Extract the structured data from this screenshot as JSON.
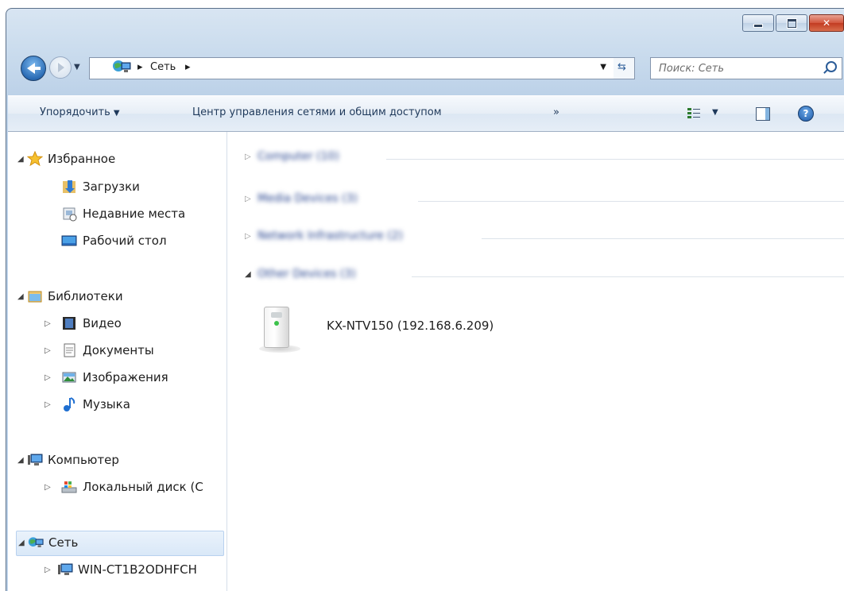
{
  "window": {
    "controls": {
      "minimize": "minimize-icon",
      "maximize": "maximize-icon",
      "close": "close-icon"
    }
  },
  "address": {
    "crumbs": [
      "Сеть"
    ],
    "search_placeholder": "Поиск: Сеть"
  },
  "toolbar": {
    "organize": "Упорядочить",
    "network_center": "Центр управления сетями и общим доступом",
    "more": "»"
  },
  "sidebar": {
    "favorites": {
      "label": "Избранное",
      "items": [
        "Загрузки",
        "Недавние места",
        "Рабочий стол"
      ]
    },
    "libraries": {
      "label": "Библиотеки",
      "items": [
        "Видео",
        "Документы",
        "Изображения",
        "Музыка"
      ]
    },
    "computer": {
      "label": "Компьютер",
      "items": [
        "Локальный диск (C"
      ]
    },
    "network": {
      "label": "Сеть",
      "items": [
        "WIN-CT1B2ODHFCH"
      ]
    }
  },
  "main": {
    "groups": [
      "Computer (10)",
      "Media Devices (3)",
      "Network Infrastructure (2)",
      "Other Devices (3)"
    ],
    "device": {
      "label": "KX-NTV150 (192.168.6.209)"
    }
  },
  "colors": {
    "accent": "#1e395b",
    "selection": "#d9e8f8"
  }
}
